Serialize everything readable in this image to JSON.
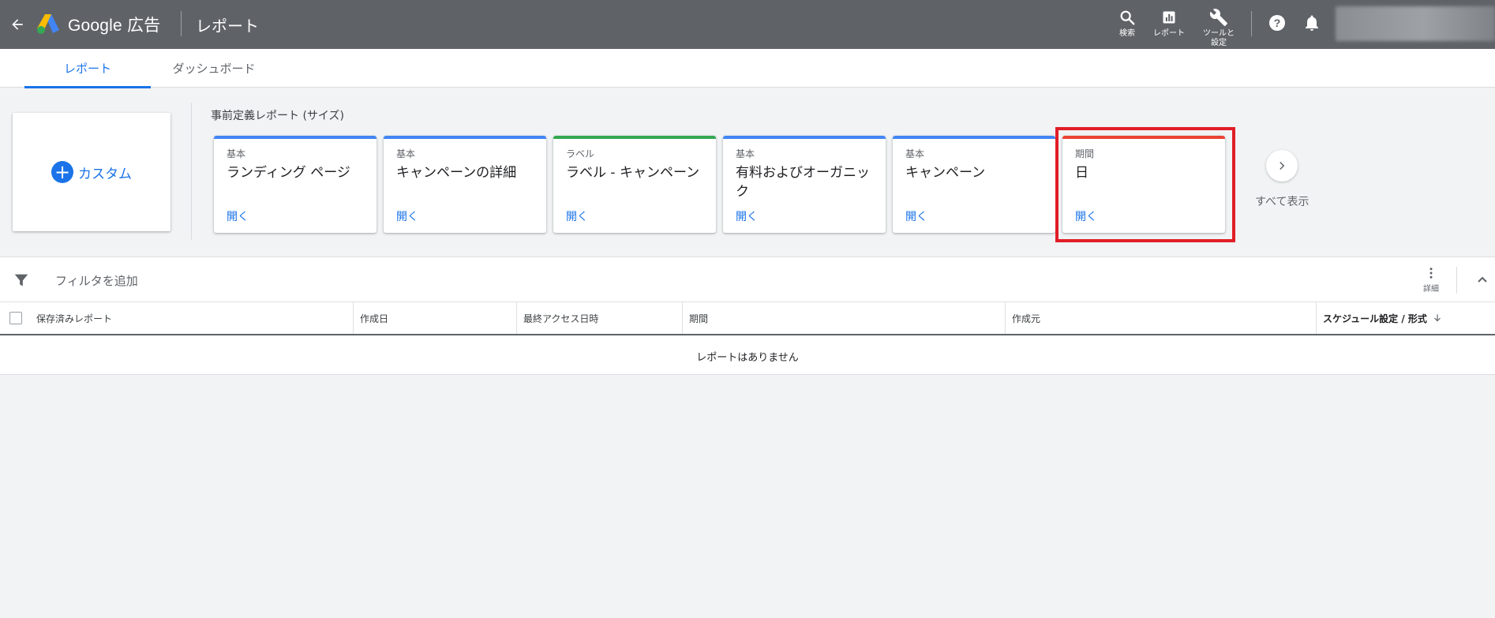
{
  "header": {
    "product_name": "Google 広告",
    "page_name": "レポート",
    "tools": [
      {
        "label": "検索",
        "icon": "search-icon"
      },
      {
        "label": "レポート",
        "icon": "bar-chart-icon"
      },
      {
        "label": "ツールと\n設定",
        "icon": "wrench-icon"
      }
    ],
    "help_icon": "help-icon",
    "notifications_icon": "bell-icon"
  },
  "tabs": [
    {
      "label": "レポート",
      "active": true
    },
    {
      "label": "ダッシュボード",
      "active": false
    }
  ],
  "custom": {
    "label": "カスタム"
  },
  "predefined": {
    "title": "事前定義レポート (サイズ)",
    "cards": [
      {
        "category": "基本",
        "name": "ランディング ページ",
        "open": "開く",
        "color": "#4285f4"
      },
      {
        "category": "基本",
        "name": "キャンペーンの詳細",
        "open": "開く",
        "color": "#4285f4"
      },
      {
        "category": "ラベル",
        "name": "ラベル - キャンペーン",
        "open": "開く",
        "color": "#34a853"
      },
      {
        "category": "基本",
        "name": "有料およびオーガニック",
        "open": "開く",
        "color": "#4285f4"
      },
      {
        "category": "基本",
        "name": "キャンペーン",
        "open": "開く",
        "color": "#4285f4"
      },
      {
        "category": "期間",
        "name": "日",
        "open": "開く",
        "color": "#ea4335"
      }
    ],
    "show_all": "すべて表示"
  },
  "filter": {
    "placeholder": "フィルタを追加",
    "more_label": "詳細"
  },
  "table": {
    "columns": [
      "保存済みレポート",
      "作成日",
      "最終アクセス日時",
      "期間",
      "作成元",
      "スケジュール設定 / 形式"
    ],
    "sorted_column": "スケジュール設定 / 形式",
    "sort_direction": "descending",
    "empty_message": "レポートはありません"
  },
  "colors": {
    "accent": "#1a73e8",
    "topbar": "#5f6368",
    "highlight": "#e11d26"
  }
}
